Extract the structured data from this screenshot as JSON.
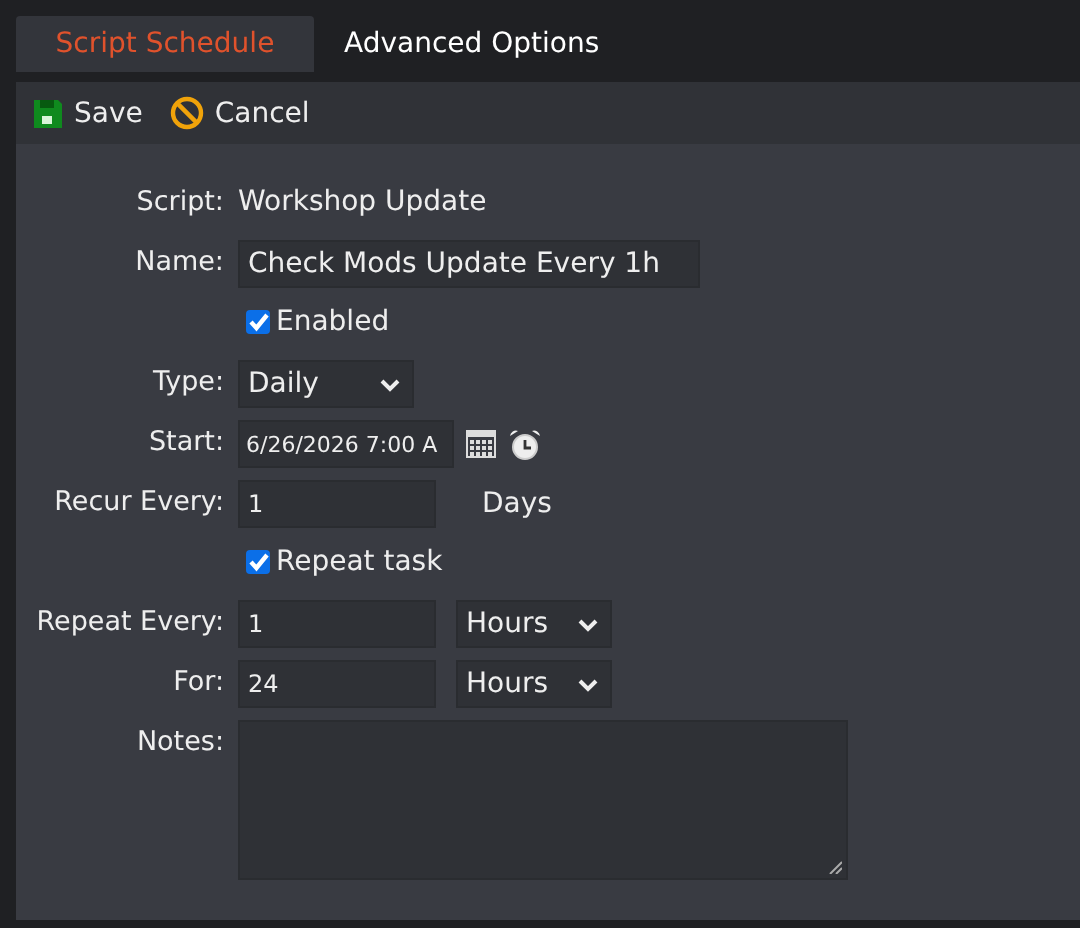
{
  "tabs": [
    {
      "label": "Script Schedule",
      "selected": true
    },
    {
      "label": "Advanced Options",
      "selected": false
    }
  ],
  "toolbar": [
    {
      "kind": "save",
      "label": "Save"
    },
    {
      "kind": "cancel",
      "label": "Cancel"
    }
  ],
  "form": [
    {
      "kind": "static",
      "label": "Script:",
      "value": "Workshop Update"
    },
    {
      "kind": "text",
      "label": "Name:",
      "value": "Check Mods Update Every 1h"
    },
    {
      "kind": "checkbox",
      "label": "Enabled",
      "checked": true
    },
    {
      "kind": "select",
      "label": "Type:",
      "value": "Daily"
    },
    {
      "kind": "datetime",
      "label": "Start:",
      "value": "6/26/2026 7:00 A"
    },
    {
      "kind": "unit",
      "label": "Recur Every:",
      "value": "1",
      "unit": "Days"
    },
    {
      "kind": "checkbox",
      "label": "Repeat task",
      "checked": true
    },
    {
      "kind": "unitselect",
      "label": "Repeat Every:",
      "value": "1",
      "unit": "Hours"
    },
    {
      "kind": "unitselect",
      "label": "For:",
      "value": "24",
      "unit": "Hours"
    },
    {
      "kind": "notes",
      "label": "Notes:"
    }
  ]
}
